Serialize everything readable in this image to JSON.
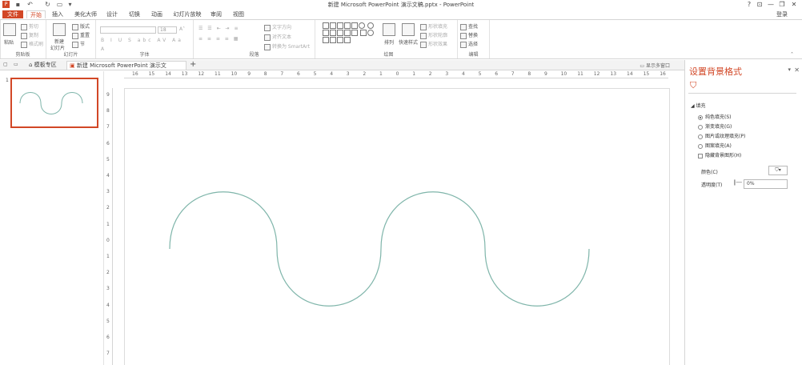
{
  "titlebar": {
    "title": "新建 Microsoft PowerPoint 演示文稿.pptx - PowerPoint",
    "help": "?",
    "ribbon_display": "⊡",
    "minimize": "—",
    "restore": "❐",
    "close": "✕"
  },
  "menu": {
    "tabs": [
      "文件",
      "开始",
      "插入",
      "美化大师",
      "设计",
      "切换",
      "动画",
      "幻灯片放映",
      "审阅",
      "视图"
    ],
    "login": "登录"
  },
  "ribbon": {
    "clipboard": {
      "label": "剪贴板",
      "paste": "粘贴",
      "cut": "剪切",
      "copy": "复制",
      "format_painter": "格式刷"
    },
    "slides": {
      "label": "幻灯片",
      "new_slide": "新建",
      "new_slide_2": "幻灯片",
      "layout": "版式",
      "reset": "重置",
      "section": "节"
    },
    "font": {
      "label": "字体",
      "size": "18"
    },
    "paragraph": {
      "label": "段落",
      "text_direction": "文字方向",
      "align_text": "对齐文本",
      "smartart": "转换为 SmartArt"
    },
    "drawing": {
      "label": "绘图",
      "arrange": "排列",
      "quick_styles": "快速样式",
      "fill": "形状填充",
      "outline": "形状轮廓",
      "effects": "形状效果"
    },
    "editing": {
      "label": "编辑",
      "find": "查找",
      "replace": "替换",
      "select": "选择"
    }
  },
  "docbar": {
    "tabs": [
      "模板专区",
      "新建 Microsoft PowerPoint 演示文稿.pptx"
    ],
    "add": "+",
    "close": "×",
    "multi_window": "显示多窗口"
  },
  "thumbnails": {
    "slide_number": "1"
  },
  "rulers": {
    "horizontal": [
      "16",
      "15",
      "14",
      "13",
      "12",
      "11",
      "10",
      "9",
      "8",
      "7",
      "6",
      "5",
      "4",
      "3",
      "2",
      "1",
      "0",
      "1",
      "2",
      "3",
      "4",
      "5",
      "6",
      "7",
      "8",
      "9",
      "10",
      "11",
      "12",
      "13",
      "14",
      "15",
      "16"
    ],
    "vertical": [
      "9",
      "8",
      "7",
      "6",
      "5",
      "4",
      "3",
      "2",
      "1",
      "0",
      "1",
      "2",
      "3",
      "4",
      "5",
      "6",
      "7"
    ]
  },
  "format_pane": {
    "title": "设置背景格式",
    "close": "✕",
    "dropdown": "▾",
    "section": "填充",
    "options": [
      "纯色填充(S)",
      "渐变填充(G)",
      "图片或纹理填充(P)",
      "图案填充(A)"
    ],
    "hide_bg": "隐藏背景图形(H)",
    "color_label": "颜色(C)",
    "transparency_label": "透明度(T)",
    "transparency_value": "0%"
  },
  "colors": {
    "accent": "#d24726",
    "curve": "#7fb5aa"
  }
}
